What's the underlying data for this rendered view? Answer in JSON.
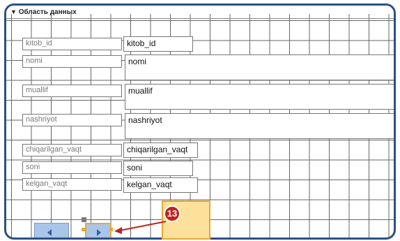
{
  "section": {
    "icon": "arrow-down-icon",
    "title": "Область данных"
  },
  "fields": [
    {
      "label": "kitob_id",
      "value": "kitob_id"
    },
    {
      "label": "nomi",
      "value": "nomi"
    },
    {
      "label": "muallif",
      "value": "muallif"
    },
    {
      "label": "nashriyot",
      "value": "nashriyot"
    },
    {
      "label": "chiqarilgan_vaqt",
      "value": "chiqarilgan_vaqt"
    },
    {
      "label": "soni",
      "value": "soni"
    },
    {
      "label": "kelgan_vaqt",
      "value": "kelgan_vaqt"
    }
  ],
  "nav": {
    "prev_icon": "triangle-left-icon",
    "next_icon": "triangle-right-icon"
  },
  "callout": {
    "number": "13"
  },
  "colors": {
    "frame_border": "#2e4f86",
    "button_fill": "#a9c6ea",
    "callout_fill": "#fde19a",
    "callout_border": "#e9a63a",
    "badge": "#c0221d",
    "arrow": "#c0221d"
  }
}
